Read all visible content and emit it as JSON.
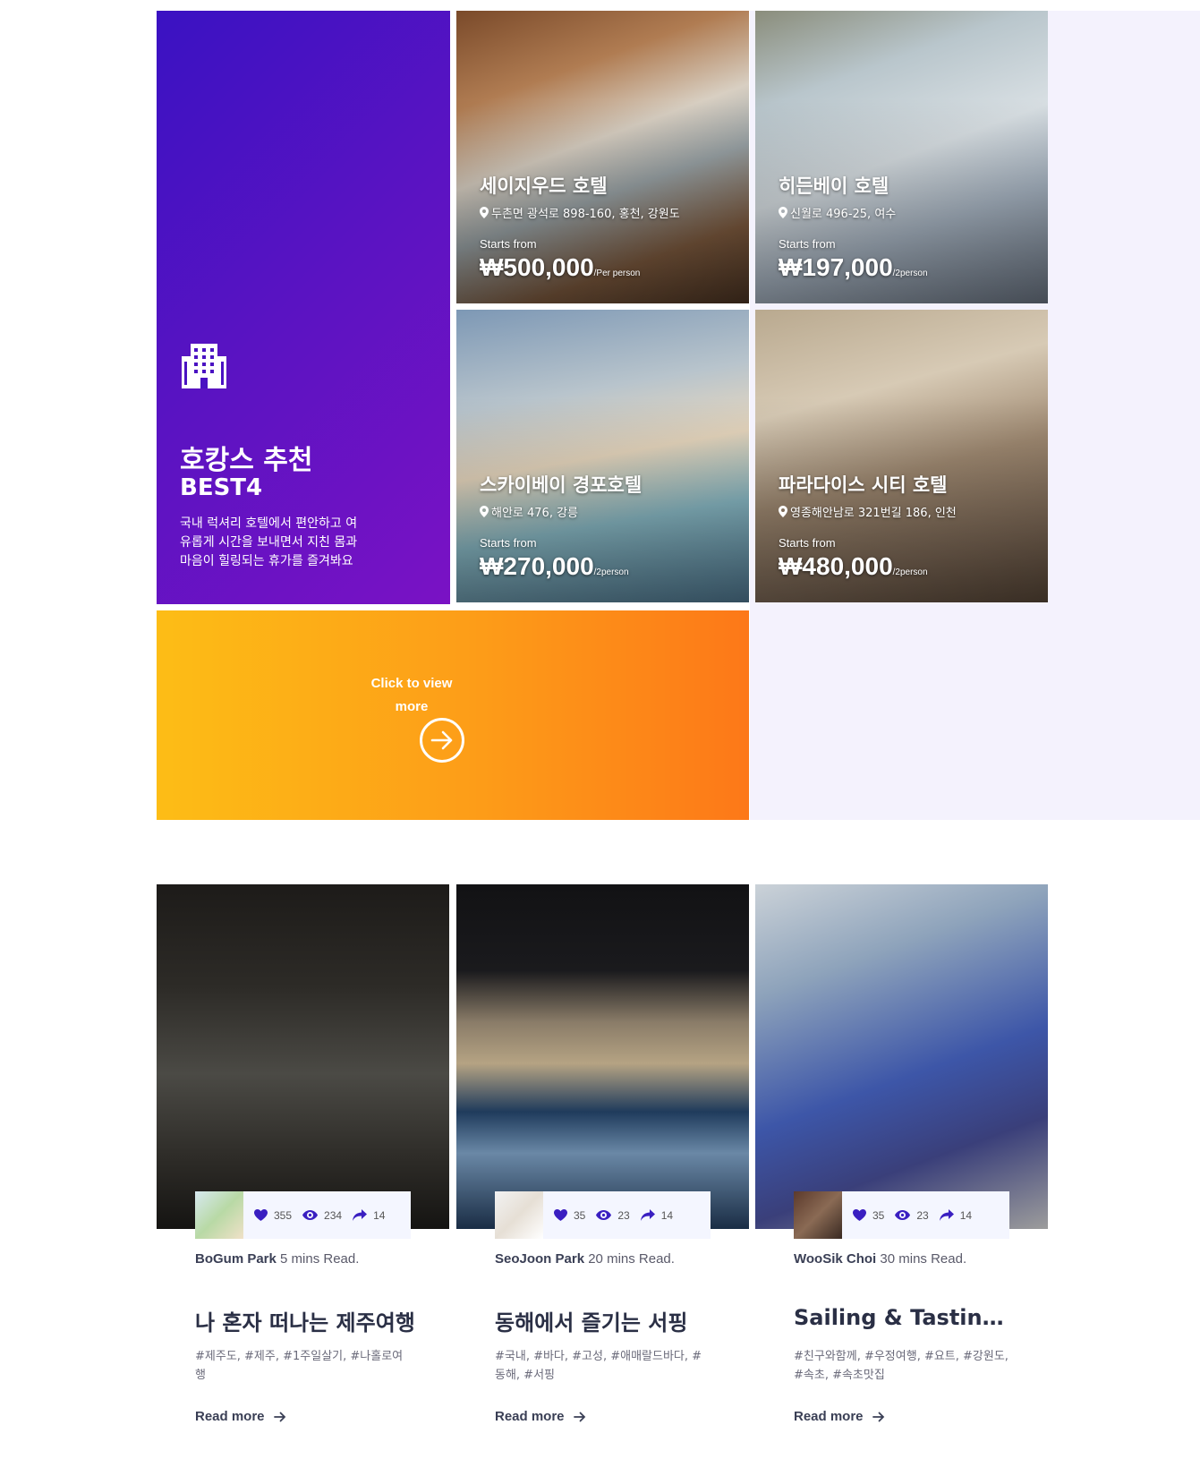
{
  "promo": {
    "title": "호캉스 추천",
    "subtitle": "BEST4",
    "description": "국내 럭셔리 호텔에서 편안하고 여유롭게 시간을 보내면서 지친 몸과 마음이 힐링되는 휴가를 즐겨봐요",
    "icon": "building-icon"
  },
  "hotels": [
    {
      "name": "세이지우드 호텔",
      "address": "두촌면 광석로 898-160, 홍천, 강원도",
      "from_label": "Starts from",
      "price": "₩500,000",
      "unit": "/Per person"
    },
    {
      "name": "히든베이 호텔",
      "address": "신월로 496-25, 여수",
      "from_label": "Starts from",
      "price": "₩197,000",
      "unit": "/2person"
    },
    {
      "name": "스카이베이 경포호텔",
      "address": "해안로 476, 강릉",
      "from_label": "Starts from",
      "price": "₩270,000",
      "unit": "/2person"
    },
    {
      "name": "파라다이스 시티 호텔",
      "address": "영종해안남로 321번길 186, 인천",
      "from_label": "Starts from",
      "price": "₩480,000",
      "unit": "/2person"
    }
  ],
  "cta": {
    "label": "Click to view more",
    "icon": "arrow-right-circle-icon"
  },
  "blogs": [
    {
      "likes": "355",
      "views": "234",
      "shares": "14",
      "author": "BoGum Park",
      "read_time": "5 mins Read.",
      "title": "나 혼자 떠나는 제주여행",
      "tags": "#제주도, #제주, #1주일살기, #나홀로여행",
      "read_more": "Read more"
    },
    {
      "likes": "35",
      "views": "23",
      "shares": "14",
      "author": "SeoJoon Park",
      "read_time": "20 mins Read.",
      "title": "동해에서 즐기는 서핑",
      "tags": "#국내, #바다, #고성, #애매랄드바다, #동해, #서핑",
      "read_more": "Read more"
    },
    {
      "likes": "35",
      "views": "23",
      "shares": "14",
      "author": "WooSik Choi",
      "read_time": "30 mins Read.",
      "title": "Sailing & Tasting in Sokcho",
      "tags": "#친구와함께, #우정여행, #요트, #강원도, #속초, #속초맛집",
      "read_more": "Read more"
    }
  ],
  "colors": {
    "accent": "#4b12c2",
    "cta_start": "#fdbd16",
    "cta_end": "#fd7818",
    "icon_blue": "#3a1fc1"
  }
}
